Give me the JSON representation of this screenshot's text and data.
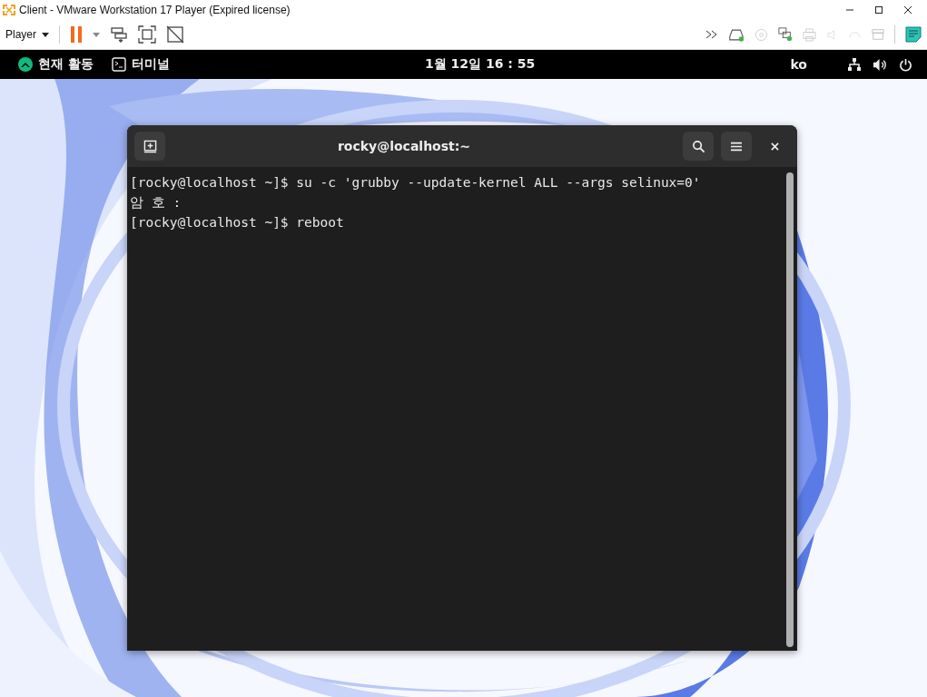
{
  "window": {
    "title": "Client - VMware Workstation 17 Player (Expired license)"
  },
  "toolbar": {
    "player_menu": "Player"
  },
  "top_bar": {
    "activities": "현재 활동",
    "app": "터미널",
    "clock": "1월 12일 16 : 55",
    "input_method": "ko"
  },
  "terminal": {
    "title": "rocky@localhost:~",
    "lines": [
      "[rocky@localhost ~]$ su -c 'grubby --update-kernel ALL --args selinux=0'",
      "암 호 :",
      "[rocky@localhost ~]$ reboot"
    ]
  }
}
